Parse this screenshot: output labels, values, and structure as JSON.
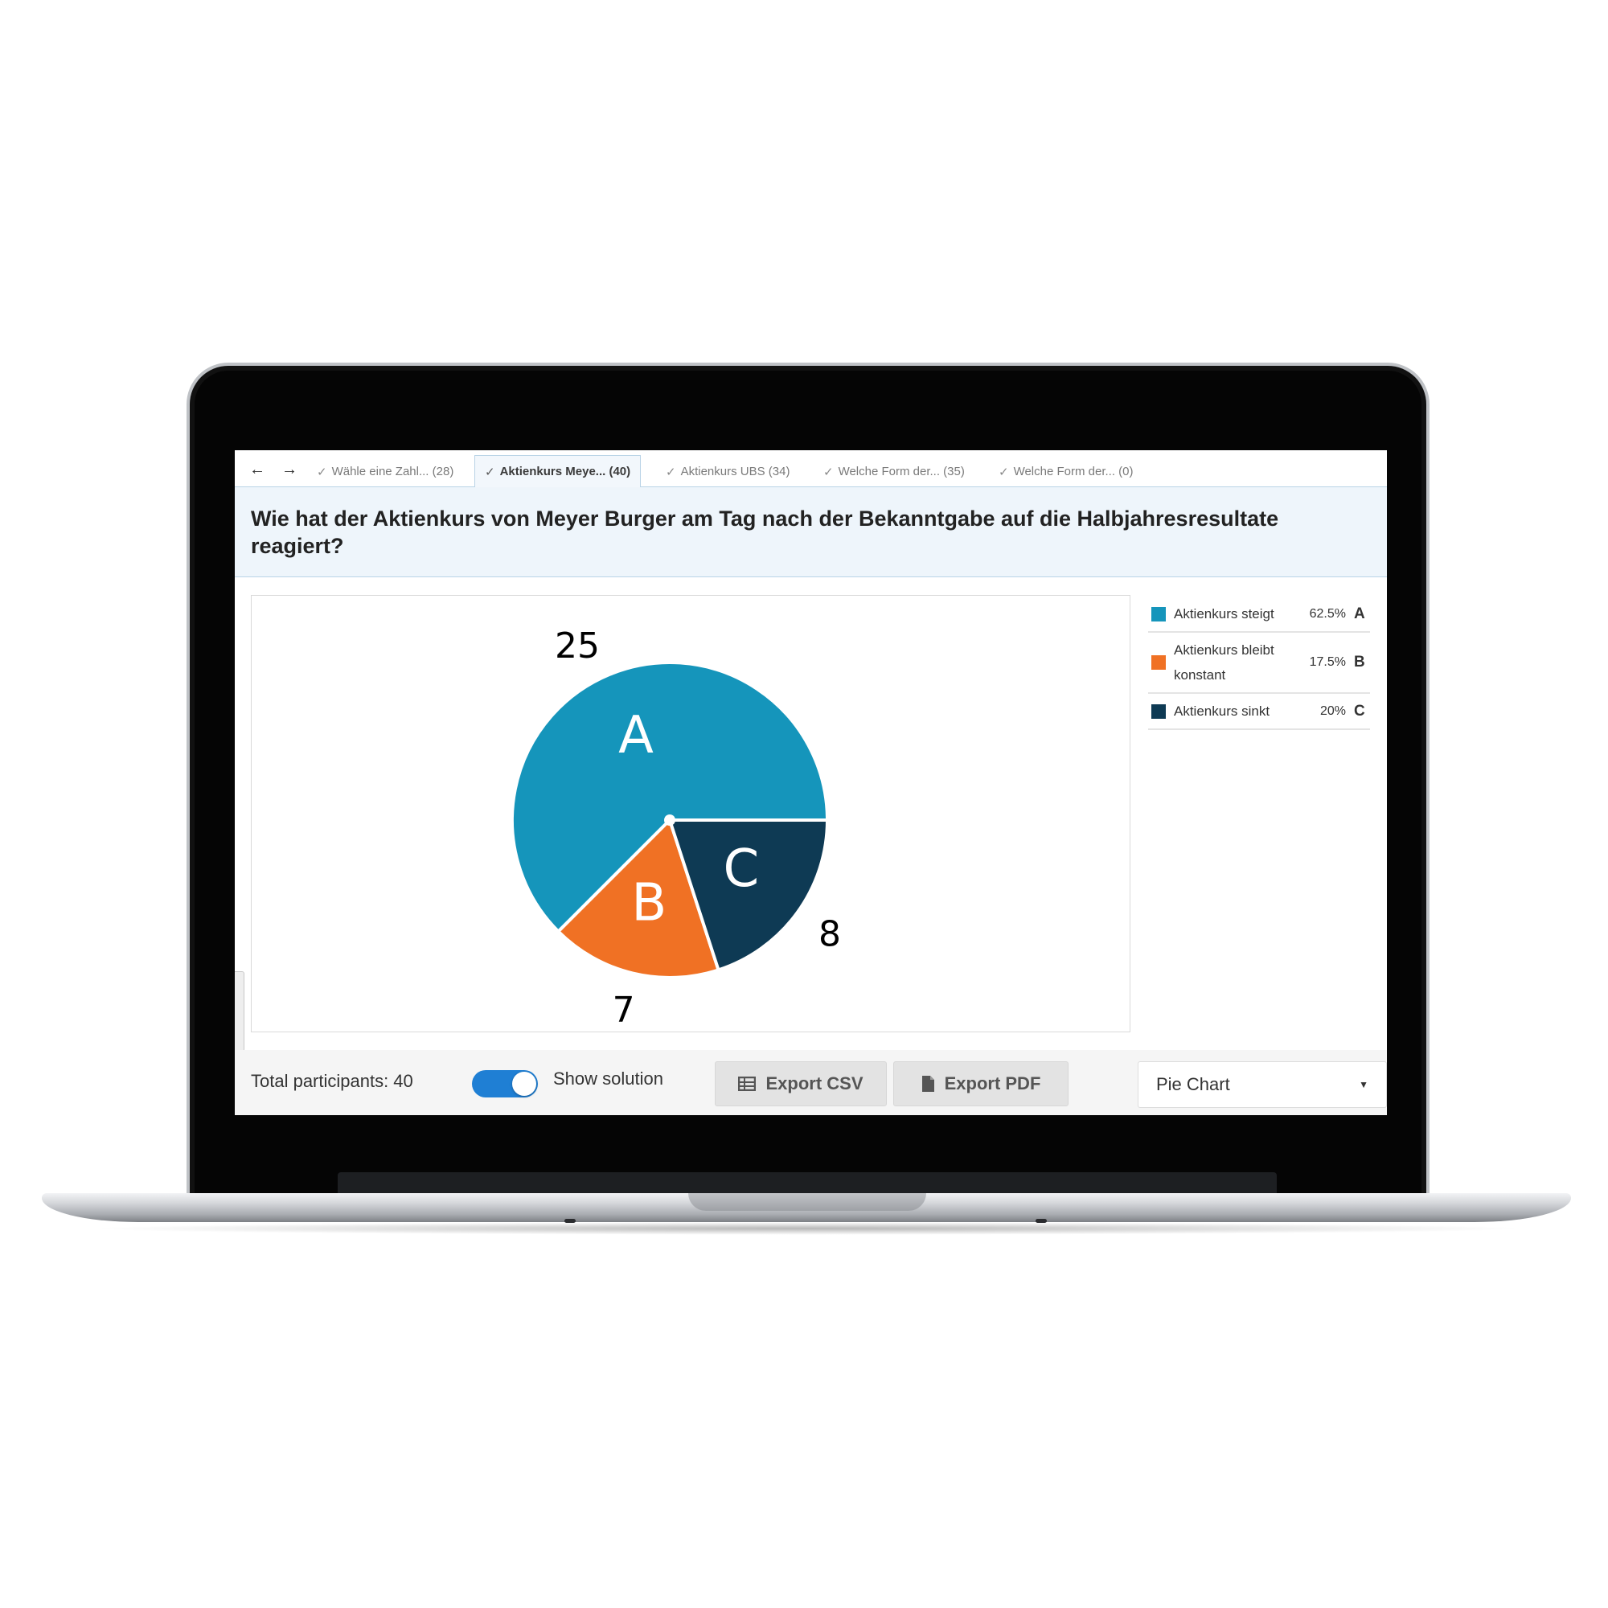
{
  "tabs": [
    {
      "label": "Wähle eine Zahl... (28)",
      "active": false
    },
    {
      "label": "Aktienkurs Meye... (40)",
      "active": true
    },
    {
      "label": "Aktienkurs UBS (34)",
      "active": false
    },
    {
      "label": "Welche Form der... (35)",
      "active": false
    },
    {
      "label": "Welche Form der... (0)",
      "active": false
    }
  ],
  "question": "Wie hat der Aktienkurs von Meyer Burger am Tag nach der Bekanntgabe auf die Halbjahresresultate reagiert?",
  "chart_data": {
    "type": "pie",
    "total": 40,
    "slices": [
      {
        "letter": "A",
        "label": "Aktienkurs steigt",
        "count": 25,
        "percent": "62.5%",
        "color": "#1595bb"
      },
      {
        "letter": "B",
        "label": "Aktienkurs bleibt konstant",
        "count": 7,
        "percent": "17.5%",
        "color": "#f07124"
      },
      {
        "letter": "C",
        "label": "Aktienkurs sinkt",
        "count": 8,
        "percent": "20%",
        "color": "#0e3a54"
      }
    ]
  },
  "footer": {
    "participants": "Total participants: 40",
    "show_solution_label": "Show solution",
    "show_solution_on": true,
    "export_csv": "Export CSV",
    "export_pdf": "Export PDF",
    "chart_type_selected": "Pie Chart"
  },
  "icons": {
    "back": "arrow-left-icon",
    "forward": "arrow-right-icon",
    "tab_check": "check-icon",
    "csv": "table-icon",
    "pdf": "file-icon",
    "dropdown": "caret-down-icon"
  }
}
